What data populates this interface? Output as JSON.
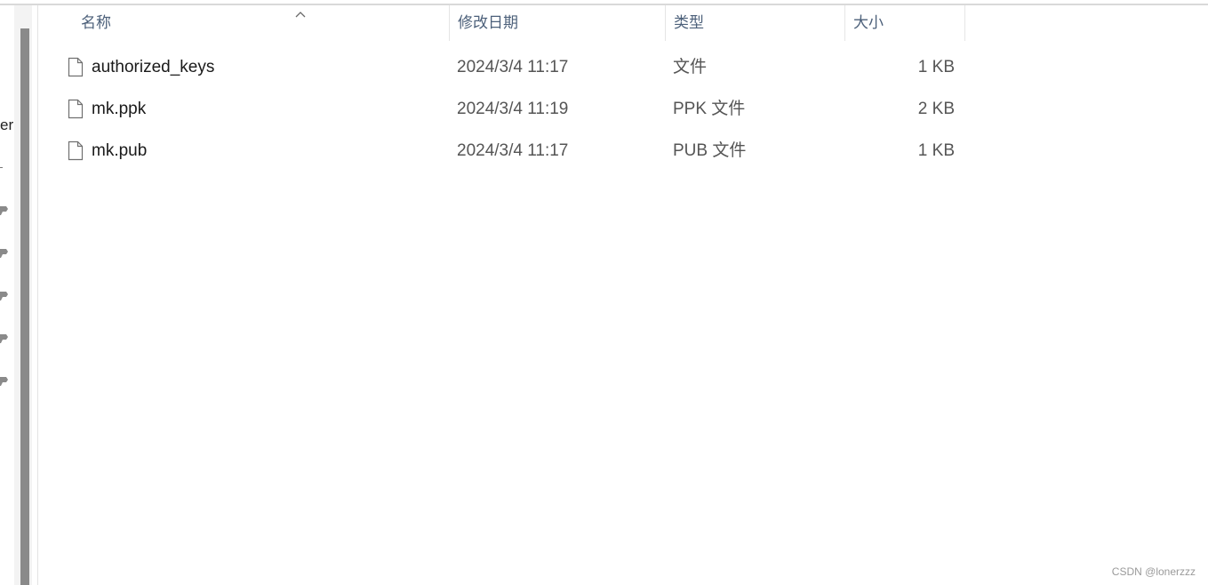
{
  "nav": {
    "partial_text": "er"
  },
  "columns": {
    "name": "名称",
    "modified": "修改日期",
    "type": "类型",
    "size": "大小"
  },
  "files": [
    {
      "name": "authorized_keys",
      "modified": "2024/3/4 11:17",
      "type": "文件",
      "size": "1 KB",
      "icon": "file-icon"
    },
    {
      "name": "mk.ppk",
      "modified": "2024/3/4 11:19",
      "type": "PPK 文件",
      "size": "2 KB",
      "icon": "file-icon"
    },
    {
      "name": "mk.pub",
      "modified": "2024/3/4 11:17",
      "type": "PUB 文件",
      "size": "1 KB",
      "icon": "file-icon"
    }
  ],
  "sort": {
    "column": "name",
    "icon": "sort-up-icon"
  },
  "watermark": "CSDN @lonerzzz",
  "colors": {
    "header_text": "#4c607a",
    "scrollbar": "#8a8a8a"
  }
}
